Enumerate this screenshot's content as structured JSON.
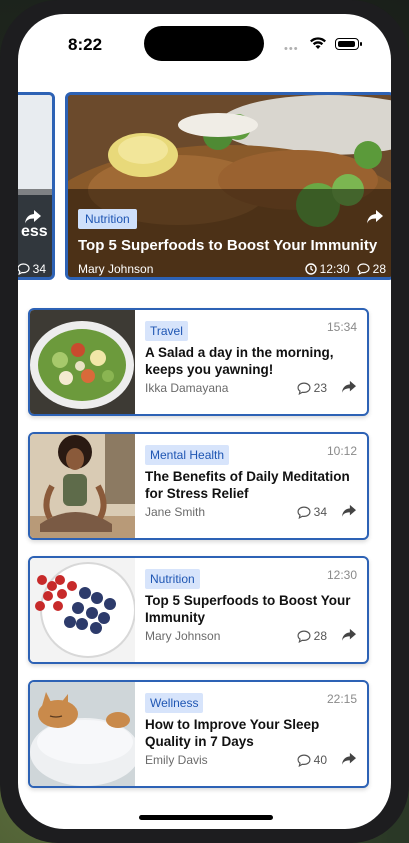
{
  "status": {
    "time": "8:22",
    "dots": "•••"
  },
  "featured": [
    {
      "tag": "",
      "title": "ess",
      "author": "",
      "comments": "34"
    },
    {
      "tag": "Nutrition",
      "title": "Top 5 Superfoods to Boost Your Immunity",
      "author": "Mary Johnson",
      "time": "12:30",
      "comments": "28"
    }
  ],
  "articles": [
    {
      "tag": "Travel",
      "time": "15:34",
      "title": "A Salad a day in the morning, keeps you yawning!",
      "author": "Ikka Damayana",
      "comments": "23",
      "thumb": "salad"
    },
    {
      "tag": "Mental Health",
      "time": "10:12",
      "title": "The Benefits of Daily Meditation for Stress Relief",
      "author": "Jane Smith",
      "comments": "34",
      "thumb": "meditation"
    },
    {
      "tag": "Nutrition",
      "time": "12:30",
      "title": "Top 5 Superfoods to Boost Your Immunity",
      "author": "Mary Johnson",
      "comments": "28",
      "thumb": "berries"
    },
    {
      "tag": "Wellness",
      "time": "22:15",
      "title": "How to Improve Your Sleep Quality in 7 Days",
      "author": "Emily Davis",
      "comments": "40",
      "thumb": "cat"
    }
  ],
  "icons": {
    "share": "share-arrow-icon",
    "comment": "comment-bubble-icon",
    "clock": "clock-icon"
  }
}
